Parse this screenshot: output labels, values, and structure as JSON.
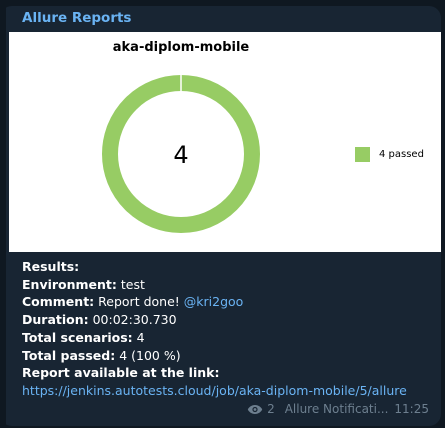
{
  "message": {
    "sender": "Allure Reports",
    "results_label": "Results:",
    "environment_label": "Environment:",
    "environment_value": "test",
    "comment_label": "Comment:",
    "comment_value": "Report done!",
    "comment_mention": "@kri2goo",
    "duration_label": "Duration:",
    "duration_value": "00:02:30.730",
    "total_scenarios_label": "Total scenarios:",
    "total_scenarios_value": "4",
    "total_passed_label": "Total passed:",
    "total_passed_value": "4 (100 %)",
    "report_link_label": "Report available at the link:",
    "report_link": "https://jenkins.autotests.cloud/job/aka-diplom-mobile/5/allure"
  },
  "meta": {
    "views": "2",
    "author": "Allure Notificati...",
    "time": "11:25"
  },
  "chart_data": {
    "type": "pie",
    "title": "aka-diplom-mobile",
    "center_label": "4",
    "categories": [
      "passed"
    ],
    "values": [
      4
    ],
    "legend": [
      "4 passed"
    ],
    "legend_placement": "right",
    "colors": [
      "#97cc64"
    ]
  }
}
